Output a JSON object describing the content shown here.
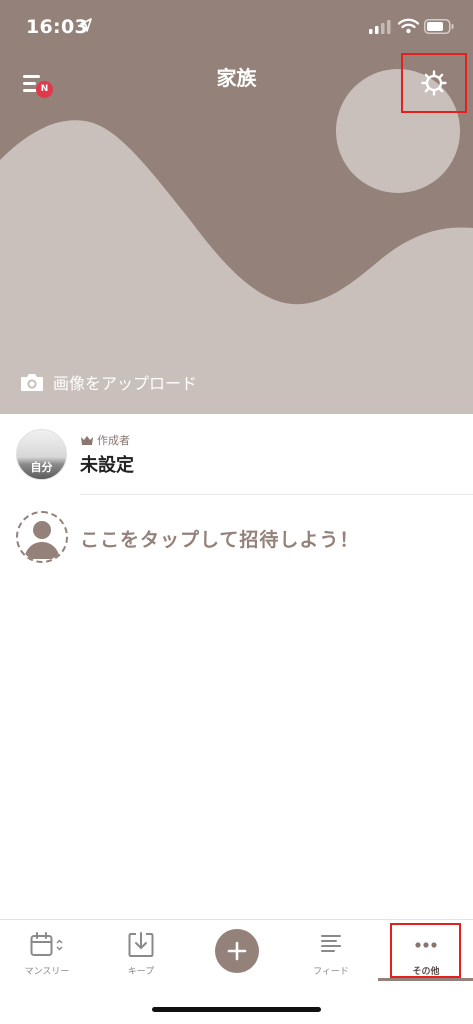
{
  "status_bar": {
    "time": "16:03"
  },
  "header": {
    "title": "家族",
    "menu_badge": "N"
  },
  "hero": {
    "upload_label": "画像をアップロード"
  },
  "members": [
    {
      "avatar_label": "自分",
      "role": "作成者",
      "name": "未設定"
    }
  ],
  "invite": {
    "label": "ここをタップして招待しよう！"
  },
  "tabbar": {
    "tabs": [
      {
        "label": "マンスリー",
        "icon": "calendar-icon"
      },
      {
        "label": "キープ",
        "icon": "download-icon"
      },
      {
        "label": "",
        "icon": "plus-icon"
      },
      {
        "label": "フィード",
        "icon": "list-icon"
      },
      {
        "label": "その他",
        "icon": "more-icon"
      }
    ],
    "active": "その他"
  },
  "colors": {
    "brand": "#94817a",
    "hero_shape": "#c9c0bc",
    "highlight": "#e32020",
    "badge": "#e03a4a"
  }
}
